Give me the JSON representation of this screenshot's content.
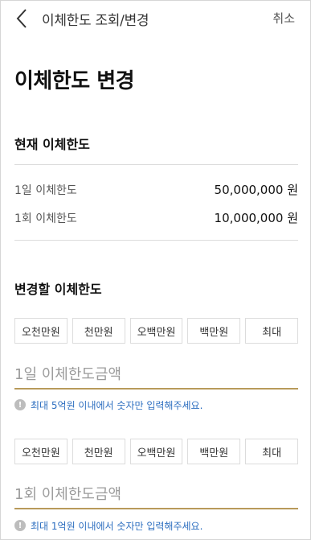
{
  "header": {
    "title": "이체한도 조회/변경",
    "cancel_label": "취소"
  },
  "page_title": "이체한도 변경",
  "current": {
    "title": "현재 이체한도",
    "rows": [
      {
        "label": "1일 이체한도",
        "value": "50,000,000 원"
      },
      {
        "label": "1회 이체한도",
        "value": "10,000,000 원"
      }
    ]
  },
  "change": {
    "title": "변경할 이체한도",
    "daily": {
      "buttons": [
        "오천만원",
        "천만원",
        "오백만원",
        "백만원",
        "최대"
      ],
      "placeholder": "1일 이체한도금액",
      "hint": "최대 5억원 이내에서 숫자만 입력해주세요."
    },
    "per_tx": {
      "buttons": [
        "오천만원",
        "천만원",
        "오백만원",
        "백만원",
        "최대"
      ],
      "placeholder": "1회 이체한도금액",
      "hint": "최대 1억원 이내에서 숫자만 입력해주세요."
    }
  },
  "icons": {
    "back": "chevron-left-icon",
    "info": "info-icon"
  },
  "colors": {
    "accent_underline": "#b89a5a",
    "hint_text": "#2e6fc0"
  }
}
